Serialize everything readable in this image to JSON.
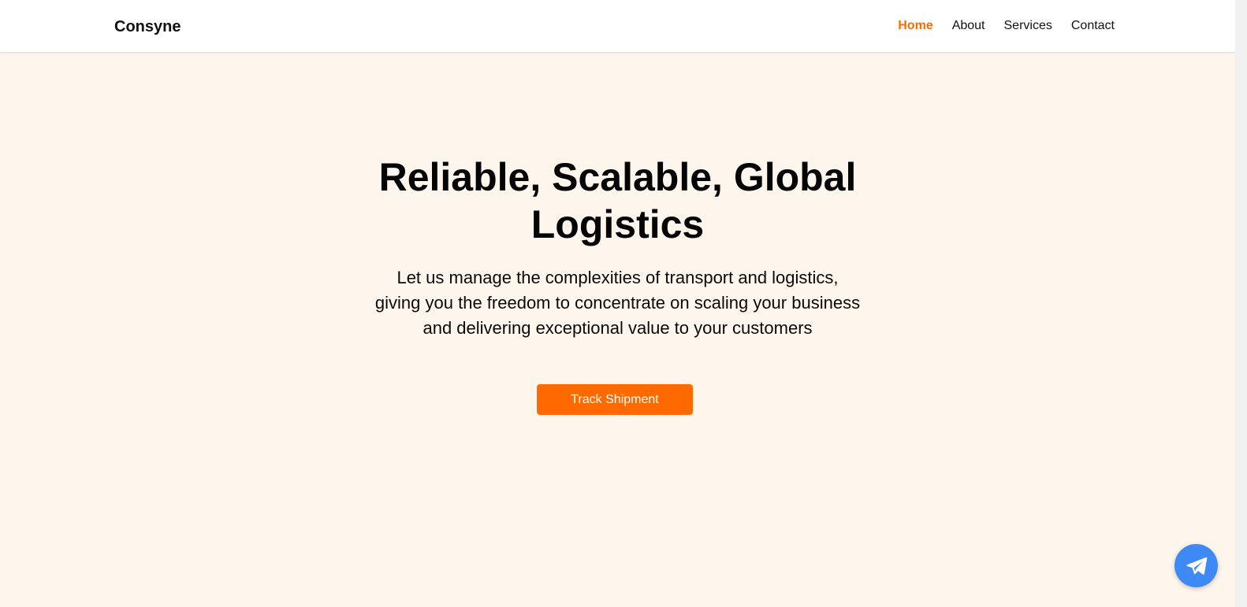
{
  "navbar": {
    "brand": "Consyne",
    "links": [
      {
        "label": "Home",
        "active": true
      },
      {
        "label": "About",
        "active": false
      },
      {
        "label": "Services",
        "active": false
      },
      {
        "label": "Contact",
        "active": false
      }
    ]
  },
  "hero": {
    "title": "Reliable, Scalable, Global Logistics",
    "subtitle": "Let us manage the complexities of transport and logistics, giving you the freedom to concentrate on scaling your business and delivering exceptional value to your customers",
    "cta_label": "Track Shipment"
  },
  "fab": {
    "icon": "paper-plane-icon"
  },
  "colors": {
    "accent": "#ff6a00",
    "hero_background": "#fef5ec",
    "fab_background": "#3d8af7"
  }
}
